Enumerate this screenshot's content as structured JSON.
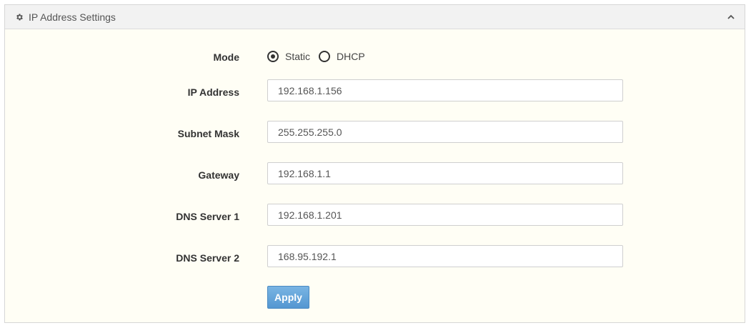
{
  "panel": {
    "title": "IP Address Settings",
    "icon": "gear-icon",
    "collapse_icon": "chevron-up-icon"
  },
  "form": {
    "mode": {
      "label": "Mode",
      "options": [
        {
          "label": "Static",
          "checked": true
        },
        {
          "label": "DHCP",
          "checked": false
        }
      ]
    },
    "ip_address": {
      "label": "IP Address",
      "value": "192.168.1.156"
    },
    "subnet_mask": {
      "label": "Subnet Mask",
      "value": "255.255.255.0"
    },
    "gateway": {
      "label": "Gateway",
      "value": "192.168.1.1"
    },
    "dns_server_1": {
      "label": "DNS Server 1",
      "value": "192.168.1.201"
    },
    "dns_server_2": {
      "label": "DNS Server 2",
      "value": "168.95.192.1"
    },
    "apply_label": "Apply"
  },
  "colors": {
    "panel_background": "#fffef5",
    "header_background": "#f2f2f2",
    "button_primary": "#5b9fd8"
  }
}
